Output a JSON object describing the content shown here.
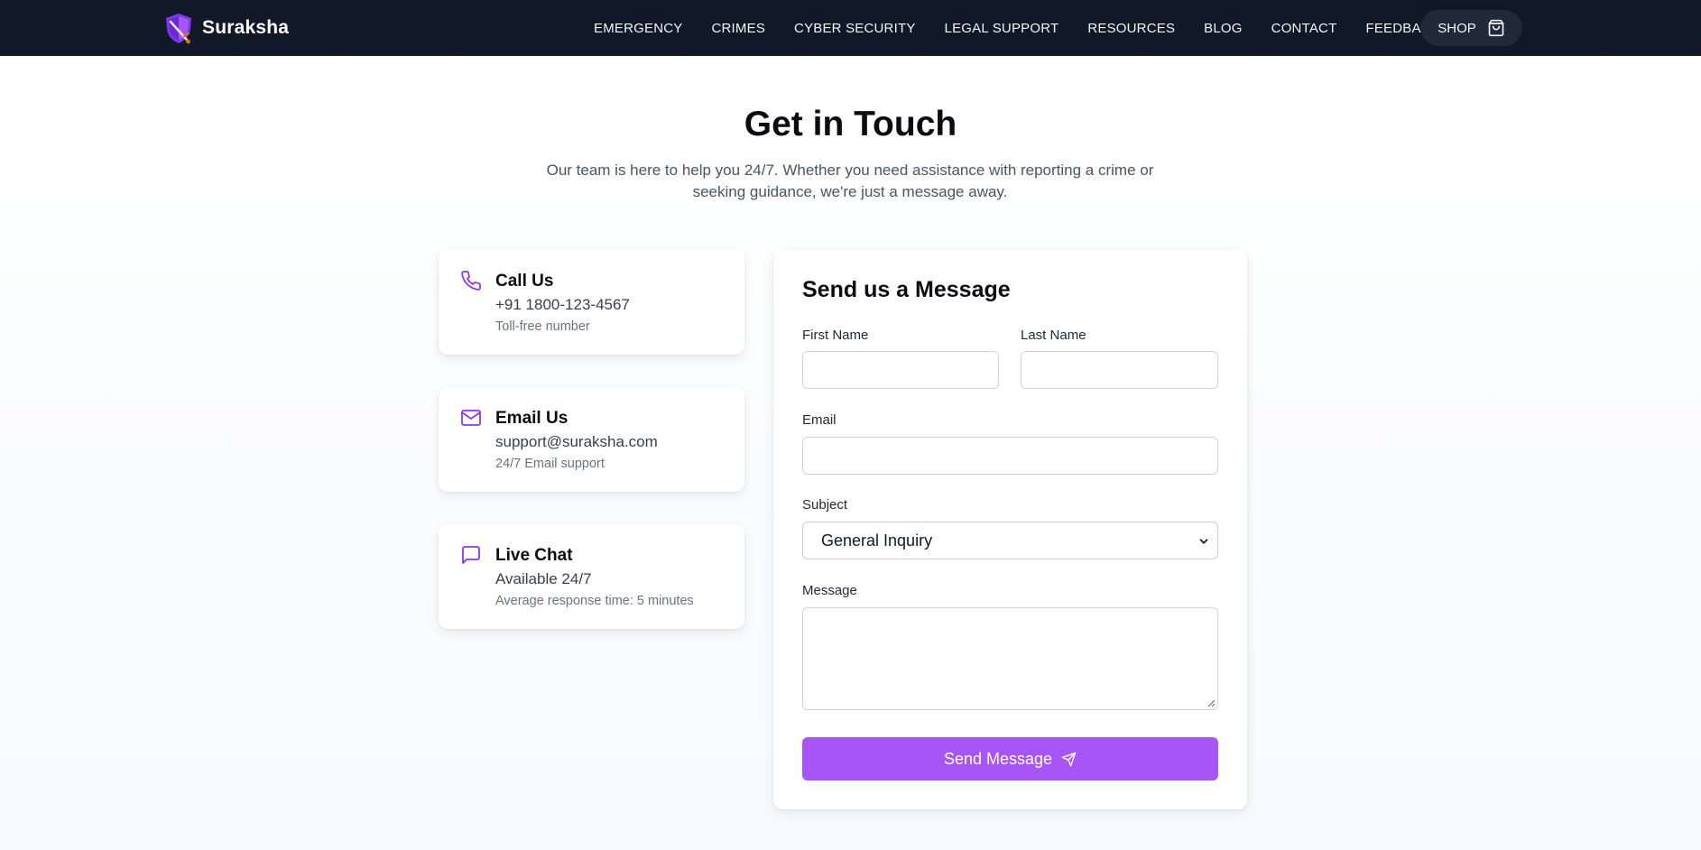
{
  "brand": {
    "name": "Suraksha",
    "logo_icon": "shield-sword-logo"
  },
  "nav": {
    "links": [
      "EMERGENCY",
      "CRIMES",
      "CYBER SECURITY",
      "LEGAL SUPPORT",
      "RESOURCES",
      "BLOG",
      "CONTACT",
      "FEEDBACK"
    ],
    "shop_label": "SHOP",
    "shop_icon": "shopping-bag-icon"
  },
  "hero": {
    "title": "Get in Touch",
    "subtitle": "Our team is here to help you 24/7. Whether you need assistance with reporting a crime or seeking guidance, we're just a message away."
  },
  "contact_cards": [
    {
      "icon": "phone-icon",
      "title": "Call Us",
      "value": "+91 1800-123-4567",
      "note": "Toll-free number"
    },
    {
      "icon": "mail-icon",
      "title": "Email Us",
      "value": "support@suraksha.com",
      "note": "24/7 Email support"
    },
    {
      "icon": "chat-icon",
      "title": "Live Chat",
      "value": "Available 24/7",
      "note": "Average response time: 5 minutes"
    }
  ],
  "form": {
    "title": "Send us a Message",
    "first_name_label": "First Name",
    "first_name_value": "",
    "last_name_label": "Last Name",
    "last_name_value": "",
    "email_label": "Email",
    "email_value": "",
    "subject_label": "Subject",
    "subject_selected": "General Inquiry",
    "message_label": "Message",
    "message_value": "",
    "submit_label": "Send Message",
    "submit_icon": "send-icon"
  },
  "colors": {
    "nav_bg": "#111827",
    "accent": "#a855f7",
    "icon_accent": "#9333ea"
  }
}
